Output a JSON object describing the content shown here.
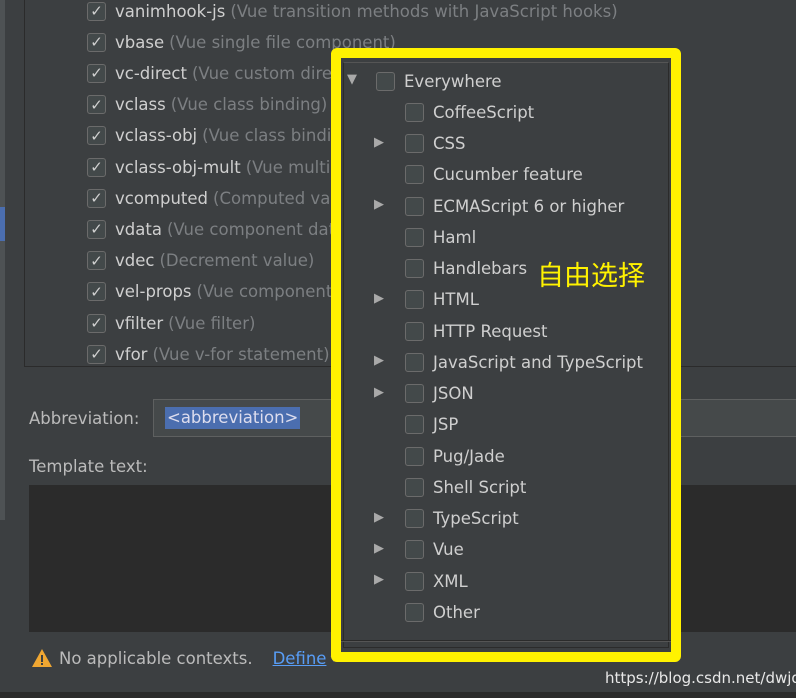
{
  "templates": [
    {
      "name": "vanimhook-js",
      "desc": "(Vue transition methods with JavaScript hooks)",
      "checked": true
    },
    {
      "name": "vbase",
      "desc": "(Vue single file component)",
      "checked": true
    },
    {
      "name": "vc-direct",
      "desc": "(Vue custom directive)",
      "checked": true
    },
    {
      "name": "vclass",
      "desc": "(Vue class binding)",
      "checked": true
    },
    {
      "name": "vclass-obj",
      "desc": "(Vue class binding)",
      "checked": true
    },
    {
      "name": "vclass-obj-mult",
      "desc": "(Vue multiple class binding)",
      "checked": true
    },
    {
      "name": "vcomputed",
      "desc": "(Computed value)",
      "checked": true
    },
    {
      "name": "vdata",
      "desc": "(Vue component data)",
      "checked": true
    },
    {
      "name": "vdec",
      "desc": "(Decrement value)",
      "checked": true
    },
    {
      "name": "vel-props",
      "desc": "(Vue component props)",
      "checked": true
    },
    {
      "name": "vfilter",
      "desc": "(Vue filter)",
      "checked": true
    },
    {
      "name": "vfor",
      "desc": "(Vue v-for statement)",
      "checked": true
    }
  ],
  "abbreviation": {
    "label": "Abbreviation:",
    "value": "<abbreviation>"
  },
  "template_text": {
    "label": "Template text:",
    "value": ""
  },
  "warning": {
    "text": "No applicable contexts.",
    "define_label": "Define"
  },
  "contexts": {
    "root": {
      "label": "Everywhere",
      "expanded": true,
      "checked": false
    },
    "children": [
      {
        "label": "CoffeeScript",
        "expandable": false
      },
      {
        "label": "CSS",
        "expandable": true
      },
      {
        "label": "Cucumber feature",
        "expandable": false
      },
      {
        "label": "ECMAScript 6 or higher",
        "expandable": true
      },
      {
        "label": "Haml",
        "expandable": false
      },
      {
        "label": "Handlebars",
        "expandable": false
      },
      {
        "label": "HTML",
        "expandable": true
      },
      {
        "label": "HTTP Request",
        "expandable": false
      },
      {
        "label": "JavaScript and TypeScript",
        "expandable": true
      },
      {
        "label": "JSON",
        "expandable": true
      },
      {
        "label": "JSP",
        "expandable": false
      },
      {
        "label": "Pug/Jade",
        "expandable": false
      },
      {
        "label": "Shell Script",
        "expandable": false
      },
      {
        "label": "TypeScript",
        "expandable": true
      },
      {
        "label": "Vue",
        "expandable": true
      },
      {
        "label": "XML",
        "expandable": true
      },
      {
        "label": "Other",
        "expandable": false
      }
    ]
  },
  "annotation": "自由选择",
  "watermark": "https://blog.csdn.net/dwjdj",
  "colors": {
    "highlight": "#fff200",
    "selection": "#4b6eaf",
    "link": "#589df6"
  }
}
